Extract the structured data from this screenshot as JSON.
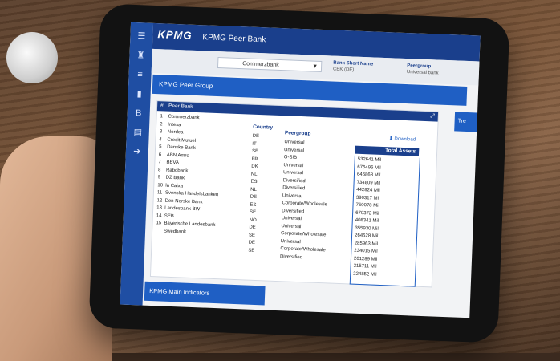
{
  "header": {
    "logo": "KPMG",
    "title": "KPMG Peer Bank"
  },
  "filters": {
    "selected_bank": "Commerzbank",
    "short_name_label": "Bank Short Name",
    "short_name_value": "CBK (DE)",
    "peergroup_label": "Peergroup",
    "peergroup_value": "Universal bank"
  },
  "section_title": "KPMG Peer Group",
  "download_label": "Download",
  "table": {
    "header_num": "#",
    "header_bank": "Peer Bank",
    "col_country": "Country",
    "col_peergroup": "Peergroup",
    "col_assets": "Total Assets",
    "rows": [
      {
        "n": "1",
        "bank": "Commerzbank",
        "country": "DE",
        "peer": "Universal",
        "assets": "532641 Mil"
      },
      {
        "n": "2",
        "bank": "Intesa",
        "country": "IT",
        "peer": "Universal",
        "assets": "676496 Mil"
      },
      {
        "n": "3",
        "bank": "Nordea",
        "country": "SE",
        "peer": "G-SIB",
        "assets": "646868 Mil"
      },
      {
        "n": "4",
        "bank": "Credit Mutuel",
        "country": "FR",
        "peer": "Universal",
        "assets": "734809 Mil"
      },
      {
        "n": "5",
        "bank": "Danske Bank",
        "country": "DK",
        "peer": "Universal",
        "assets": "442824 Mil"
      },
      {
        "n": "6",
        "bank": "ABN Amro",
        "country": "NL",
        "peer": "Diversified",
        "assets": "390317 Mil"
      },
      {
        "n": "7",
        "bank": "BBVA",
        "country": "ES",
        "peer": "Diversified",
        "assets": "750078 Mil"
      },
      {
        "n": "8",
        "bank": "Rabobank",
        "country": "NL",
        "peer": "Universal",
        "assets": "670372 Mil"
      },
      {
        "n": "9",
        "bank": "DZ Bank",
        "country": "DE",
        "peer": "Corporate/Wholesale",
        "assets": "408341 Mil"
      },
      {
        "n": "10",
        "bank": "la Caixa",
        "country": "ES",
        "peer": "Diversified",
        "assets": "355930 Mil"
      },
      {
        "n": "11",
        "bank": "Svenska Handelsbanken",
        "country": "SE",
        "peer": "Universal",
        "assets": "264528 Mil"
      },
      {
        "n": "12",
        "bank": "Den Norske Bank",
        "country": "NO",
        "peer": "Universal",
        "assets": "285963 Mil"
      },
      {
        "n": "13",
        "bank": "Landesbank BW",
        "country": "DE",
        "peer": "Corporate/Wholesale",
        "assets": "234015 Mil"
      },
      {
        "n": "14",
        "bank": "SEB",
        "country": "SE",
        "peer": "Universal",
        "assets": "261289 Mil"
      },
      {
        "n": "15",
        "bank": "Bayerische Landesbank",
        "country": "DE",
        "peer": "Corporate/Wholesale",
        "assets": "215711 Mil"
      },
      {
        "n": "",
        "bank": "Swedbank",
        "country": "SE",
        "peer": "Diversified",
        "assets": "224852 Mil"
      }
    ]
  },
  "bottom_section": "KPMG Main Indicators",
  "side_tab": "Tre",
  "rail_icons": [
    "menu-icon",
    "binoculars-icon",
    "list-icon",
    "bar-chart-icon",
    "b-icon",
    "document-icon",
    "arrow-icon"
  ],
  "colors": {
    "primary": "#1a3f8c",
    "accent": "#1f5fc4"
  }
}
